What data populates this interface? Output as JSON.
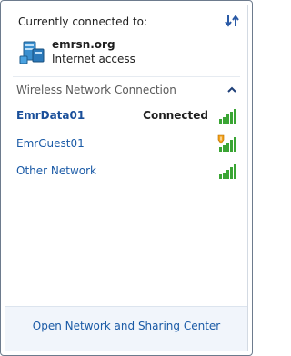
{
  "header": {
    "title": "Currently connected to:"
  },
  "current_network": {
    "name": "emrsn.org",
    "access": "Internet access"
  },
  "section": {
    "title": "Wireless Network Connection"
  },
  "networks": [
    {
      "name": "EmrData01",
      "status": "Connected",
      "signal_bars": 5,
      "secured": true
    },
    {
      "name": "EmrGuest01",
      "status": "",
      "signal_bars": 5,
      "shield_warning": true
    },
    {
      "name": "Other Network",
      "status": "",
      "signal_bars": 5
    }
  ],
  "footer": {
    "link": "Open Network and Sharing Center"
  },
  "colors": {
    "link": "#1a5aa6",
    "signal": "#3aa534",
    "footer_bg": "#f1f5fb"
  }
}
